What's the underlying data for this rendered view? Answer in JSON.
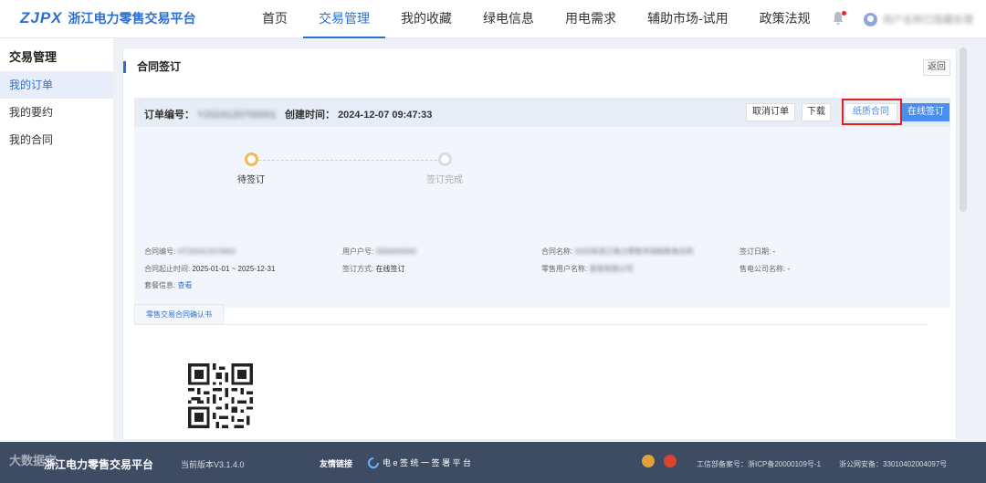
{
  "header": {
    "logo_mark": "ZJPX",
    "logo_text": "浙江电力零售交易平台",
    "nav": [
      "首页",
      "交易管理",
      "我的收藏",
      "绿电信息",
      "用电需求",
      "辅助市场-试用",
      "政策法规"
    ],
    "active_nav_index": 1,
    "user_name": "用户名称已隐藏处理"
  },
  "sidebar": {
    "title": "交易管理",
    "items": [
      "我的订单",
      "我的要约",
      "我的合同"
    ],
    "active_index": 0
  },
  "main": {
    "title": "合同签订",
    "back_label": "返回",
    "order": {
      "order_no_label": "订单编号：",
      "order_no_value": "Y2024120700001",
      "created_label": "创建时间：",
      "created_value": "2024-12-07 09:47:33",
      "buttons": {
        "cancel": "取消订单",
        "download": "下载",
        "paper": "纸质合同",
        "online": "在线签订"
      }
    },
    "steps": [
      "待签订",
      "签订完成"
    ],
    "active_step_index": 0,
    "info": {
      "contract_no_label": "合同编号:",
      "contract_no_value": "HT202412070001",
      "account_label": "用户户号:",
      "account_value": "3300000000",
      "contract_name_label": "合同名称:",
      "contract_name_value": "2025年浙江电力零售市场购售电合同",
      "sign_date_label": "签订日期:",
      "sign_date_value": "-",
      "period_label": "合同起止时间:",
      "period_value": "2025-01-01 ~ 2025-12-31",
      "sign_method_label": "签订方式:",
      "sign_method_value": "在线签订",
      "retail_user_label": "零售用户名称:",
      "retail_user_value": "某某有限公司",
      "seller_label": "售电公司名称:",
      "seller_value": "-",
      "package_label": "套餐信息:",
      "package_link": "查看"
    },
    "doc_tab": "零售交易合同确认书"
  },
  "footer": {
    "title": "浙江电力零售交易平台",
    "version": "当前版本V3.1.4.0",
    "links_label": "友情链接",
    "esign": "电 e 签 统 一 签 署 平 台",
    "icp": "工信部备案号：浙ICP备20000109号-1",
    "police": "浙公网安备：33010402004097号",
    "watermark": "大数据宝"
  }
}
